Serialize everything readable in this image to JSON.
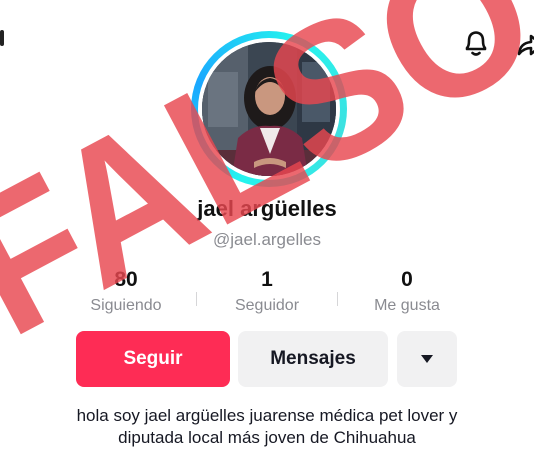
{
  "header": {
    "icons": [
      "bell-icon",
      "share-icon"
    ]
  },
  "profile": {
    "display_name": "jael argüelles",
    "username": "@jael.argelles",
    "avatar_icon": "profile-photo"
  },
  "stats": [
    {
      "value": "80",
      "label": "Siguiendo"
    },
    {
      "value": "1",
      "label": "Seguidor"
    },
    {
      "value": "0",
      "label": "Me gusta"
    }
  ],
  "actions": {
    "follow_label": "Seguir",
    "message_label": "Mensajes",
    "more_icon": "caret-down-icon"
  },
  "bio": {
    "line1": "hola soy jael argüelles juarense médica pet lover y",
    "line2": "diputada local más joven de Chihuahua"
  },
  "overlay": {
    "stamp_text": "FALSO",
    "color": "#e8474f"
  },
  "colors": {
    "follow": "#fe2c55",
    "ring": "#25f4ee",
    "secondary_btn": "#f1f1f2"
  }
}
